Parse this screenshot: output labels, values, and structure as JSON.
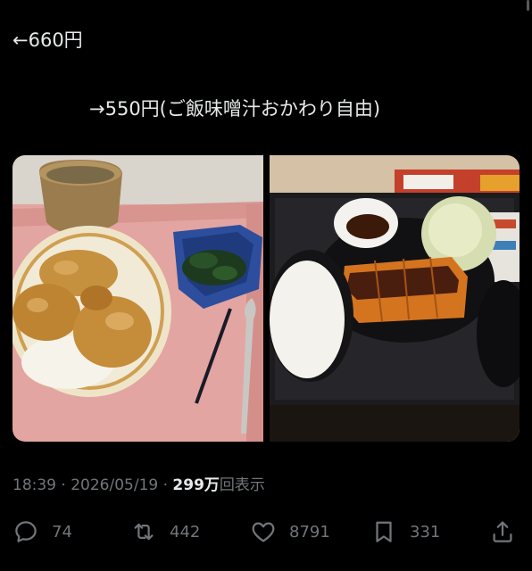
{
  "tweet": {
    "text_line1": "←660円",
    "text_line2": "→550円(ご飯味噌汁おかわり自由)"
  },
  "media": {
    "images": [
      {
        "name": "tendon-bowl-tray"
      },
      {
        "name": "tonkatsu-set-meal"
      }
    ]
  },
  "meta": {
    "time": "18:39",
    "date": "2026/05/19",
    "separator": "·",
    "views_count": "299万",
    "views_label": "回表示"
  },
  "actions": {
    "reply_count": "74",
    "retweet_count": "442",
    "like_count": "8791",
    "bookmark_count": "331"
  },
  "icons": {
    "reply": "reply-bubble-icon",
    "retweet": "retweet-icon",
    "like": "heart-icon",
    "bookmark": "bookmark-icon",
    "share": "share-icon"
  },
  "colors": {
    "background": "#000000",
    "text_primary": "#e7e9ea",
    "text_secondary": "#71767b"
  }
}
